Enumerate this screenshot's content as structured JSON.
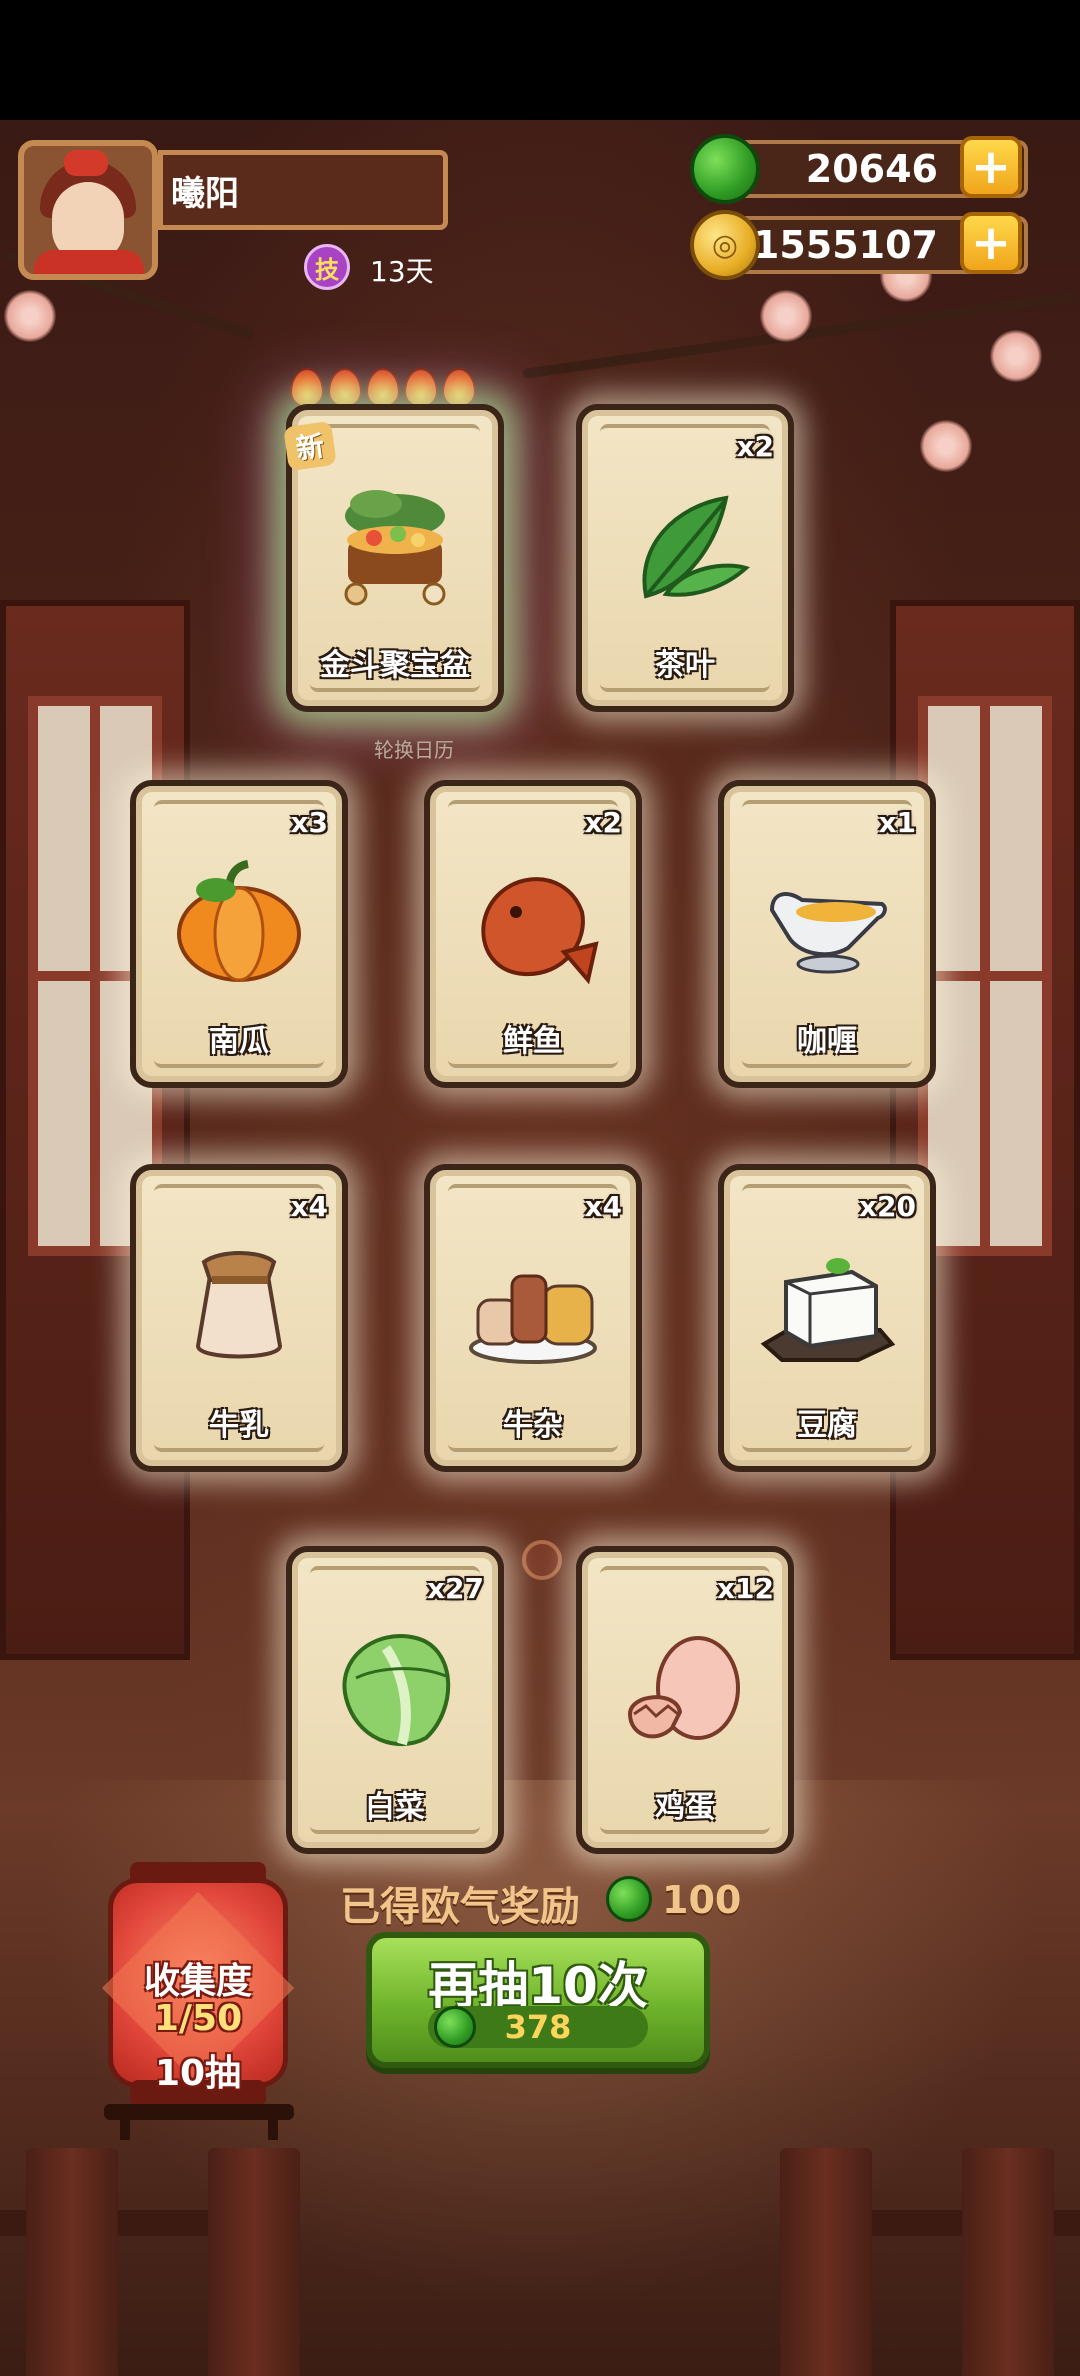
{
  "player": {
    "name": "曦阳",
    "skill_badge": "技",
    "days": "13天"
  },
  "currency": {
    "jade": "20646",
    "coins": "1555107",
    "jade_icon": "jade-gem-icon",
    "coin_icon": "copper-coin-icon",
    "plus_label": "+"
  },
  "featured_card": {
    "new_tag": "新",
    "name": "金斗聚宝盆",
    "star_count": 5,
    "subtitle": "轮换日历"
  },
  "cards": [
    {
      "name": "茶叶",
      "count": "x2",
      "icon": "tea-leaf-icon"
    },
    {
      "name": "南瓜",
      "count": "x3",
      "icon": "pumpkin-icon"
    },
    {
      "name": "鲜鱼",
      "count": "x2",
      "icon": "fish-icon"
    },
    {
      "name": "咖喱",
      "count": "x1",
      "icon": "curry-icon"
    },
    {
      "name": "牛乳",
      "count": "x4",
      "icon": "milk-jar-icon"
    },
    {
      "name": "牛杂",
      "count": "x4",
      "icon": "beef-offal-icon"
    },
    {
      "name": "豆腐",
      "count": "x20",
      "icon": "tofu-icon"
    },
    {
      "name": "白菜",
      "count": "x27",
      "icon": "cabbage-icon"
    },
    {
      "name": "鸡蛋",
      "count": "x12",
      "icon": "egg-icon"
    }
  ],
  "reward": {
    "label": "已得欧气奖励",
    "amount": "100"
  },
  "draw_button": {
    "label": "再抽10次",
    "cost": "378"
  },
  "collection": {
    "title": "收集度",
    "progress": "1/50",
    "draws": "10抽"
  },
  "colors": {
    "card_bg": "#f3e6c6",
    "card_border": "#3b2418",
    "draw_button": "#6fb42c",
    "lantern": "#e0463a",
    "accent_gold": "#f0a51c"
  }
}
